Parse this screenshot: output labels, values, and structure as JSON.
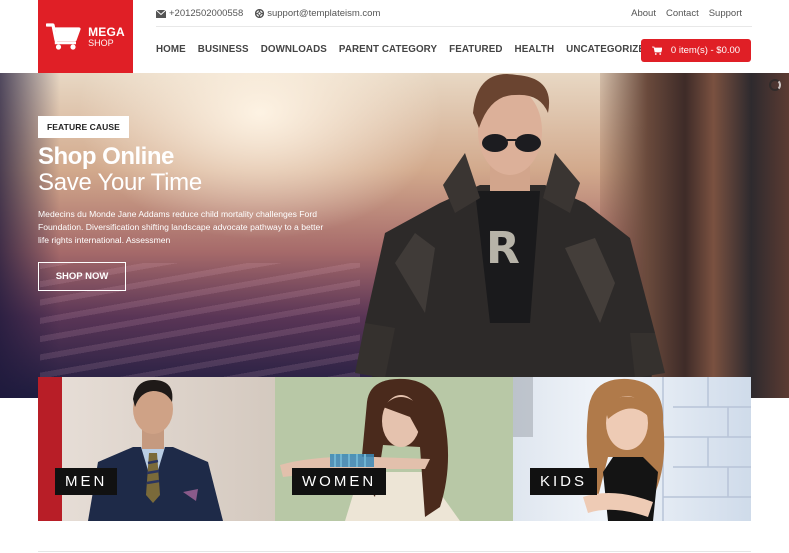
{
  "brand": {
    "name_line1": "MEGA",
    "name_line2": "SHOP",
    "accent_color": "#e01f26"
  },
  "topbar": {
    "phone_icon": "envelope-icon",
    "phone": "+2012502000558",
    "email_icon": "support-lifebuoy-icon",
    "email": "support@templateism.com",
    "links": [
      "About",
      "Contact",
      "Support"
    ]
  },
  "nav": {
    "items": [
      "HOME",
      "BUSINESS",
      "DOWNLOADS",
      "PARENT CATEGORY",
      "FEATURED",
      "HEALTH",
      "UNCATEGORIZED"
    ]
  },
  "cart": {
    "icon": "cart-icon",
    "label": "0 item(s) - $0.00"
  },
  "hero": {
    "badge": "FEATURE CAUSE",
    "title_bold": "Shop Online",
    "title_light": "Save Your Time",
    "description": "Medecins du Monde Jane Addams reduce child mortality challenges Ford Foundation. Diversification shifting landscape advocate pathway to a better life rights international. Assessmen",
    "cta": "SHOP NOW"
  },
  "categories": [
    {
      "label": "MEN"
    },
    {
      "label": "WOMEN"
    },
    {
      "label": "KIDS"
    }
  ]
}
